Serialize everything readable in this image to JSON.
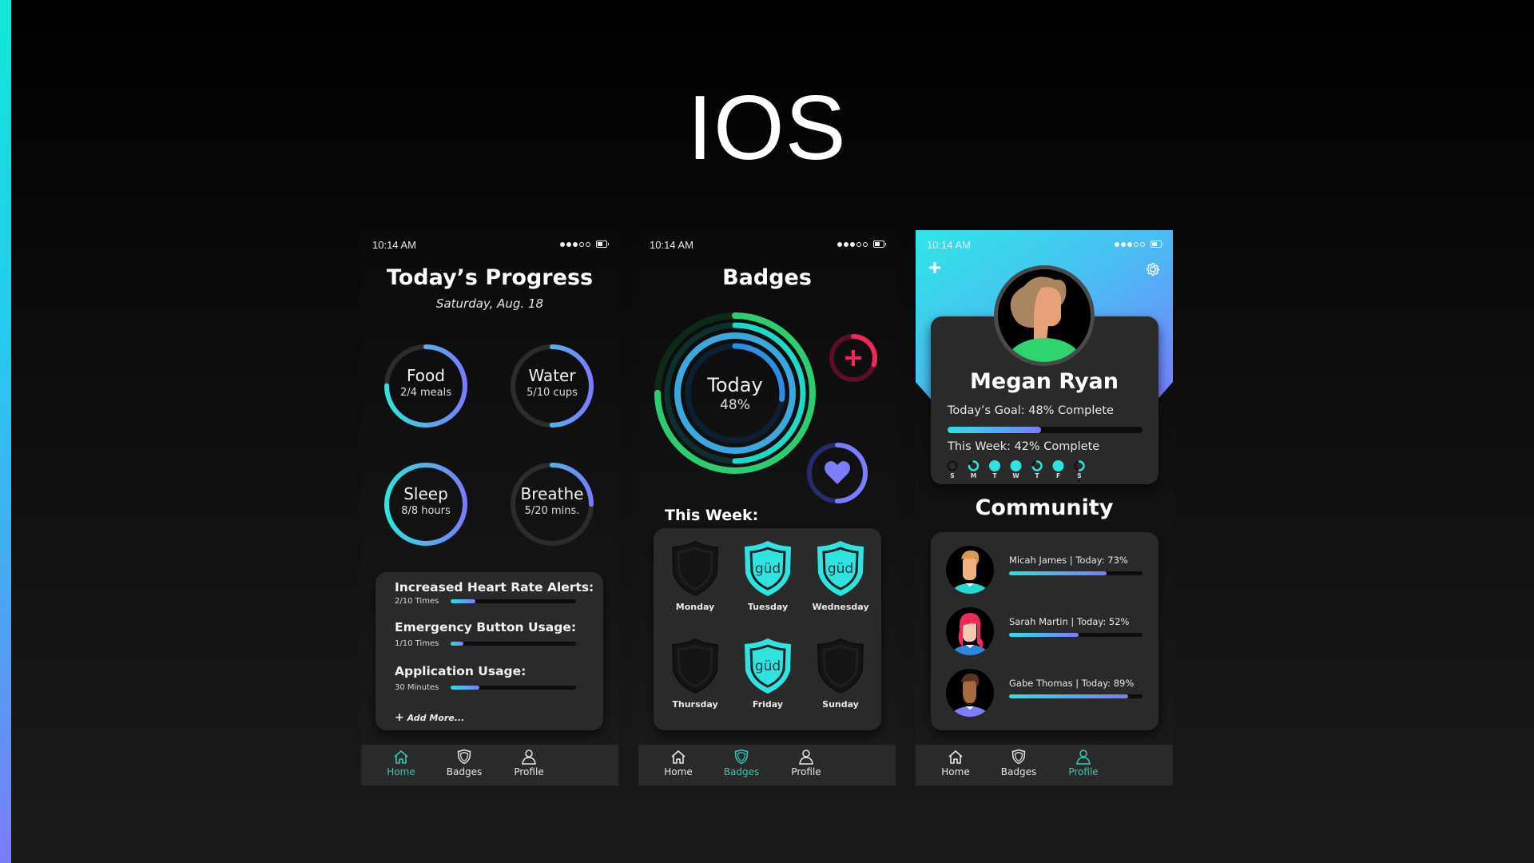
{
  "deck_title": "IOS",
  "accent_colors": {
    "cyan": "#2fe0e0",
    "purple": "#7a7cff",
    "active_tab": "#36c9b8"
  },
  "status_bar": {
    "time": "10:14 AM",
    "signal_icon": "signal-dots-icon",
    "battery_icon": "battery-icon"
  },
  "tabs": [
    {
      "label": "Home",
      "icon": "home-icon"
    },
    {
      "label": "Badges",
      "icon": "shield-icon"
    },
    {
      "label": "Profile",
      "icon": "person-icon"
    }
  ],
  "screens": {
    "progress": {
      "title": "Today’s Progress",
      "date": "Saturday, Aug. 18",
      "active_tab": "Home",
      "rings": [
        {
          "label": "Food",
          "detail": "2/4 meals",
          "progress": 0.75
        },
        {
          "label": "Water",
          "detail": "5/10 cups",
          "progress": 0.5
        },
        {
          "label": "Sleep",
          "detail": "8/8 hours",
          "progress": 1.0
        },
        {
          "label": "Breathe",
          "detail": "5/20 mins.",
          "progress": 0.25
        }
      ],
      "metrics": [
        {
          "title": "Increased Heart Rate Alerts:",
          "detail": "2/10 Times",
          "progress": 0.2
        },
        {
          "title": "Emergency Button Usage:",
          "detail": "1/10 Times",
          "progress": 0.1
        },
        {
          "title": "Application Usage:",
          "detail": "30 Minutes",
          "progress": 0.23
        }
      ],
      "add_more": "Add More..."
    },
    "badges": {
      "title": "Badges",
      "active_tab": "Badges",
      "today_label": "Today",
      "today_value": "48%",
      "activity_rings": [
        {
          "name": "outer",
          "color": "#2ecc71",
          "track": "#0b2a17",
          "progress": 0.75
        },
        {
          "name": "second",
          "color": "#1ed8c8",
          "track": "#0d2f2e",
          "progress": 0.5
        },
        {
          "name": "third",
          "color": "#3aa8dc",
          "track": "#0f2a3a",
          "progress": 1.0
        },
        {
          "name": "inner",
          "color": "#2c8fe3",
          "track": "#0c2033",
          "progress": 0.27
        }
      ],
      "emergency_ring": {
        "icon": "plus-icon",
        "color": "#f0285a",
        "track": "#5a0f24",
        "progress": 0.3
      },
      "heart_ring": {
        "icon": "heart-icon",
        "color": "#7b7cff",
        "track": "#252a6a",
        "progress": 0.5
      },
      "week_label": "This Week:",
      "badge_text": "güd",
      "days": [
        {
          "day": "Monday",
          "earned": false
        },
        {
          "day": "Tuesday",
          "earned": true
        },
        {
          "day": "Wednesday",
          "earned": true
        },
        {
          "day": "Thursday",
          "earned": false
        },
        {
          "day": "Friday",
          "earned": true
        },
        {
          "day": "Sunday",
          "earned": false
        }
      ]
    },
    "profile": {
      "active_tab": "Profile",
      "add_icon": "plus-icon",
      "settings_icon": "gear-icon",
      "name": "Megan Ryan",
      "today_goal": "Today’s Goal: 48% Complete",
      "today_progress": 0.48,
      "this_week": "This Week: 42% Complete",
      "week_days": [
        {
          "d": "S",
          "progress": 0
        },
        {
          "d": "M",
          "progress": 0.75
        },
        {
          "d": "T",
          "progress": 1
        },
        {
          "d": "W",
          "progress": 1
        },
        {
          "d": "T",
          "progress": 0.7
        },
        {
          "d": "F",
          "progress": 1
        },
        {
          "d": "S",
          "progress": 0.5,
          "today": true
        }
      ],
      "community_title": "Community",
      "community": [
        {
          "label": "Micah James | Today: 73%",
          "progress": 0.73,
          "shirt": "#27d8d0",
          "hair": "#d99a55",
          "skin": "#f0b080"
        },
        {
          "label": "Sarah Martin | Today: 52%",
          "progress": 0.52,
          "shirt": "#2f86e0",
          "hair": "#ee2a5a",
          "skin": "#f6c8b0"
        },
        {
          "label": "Gabe Thomas | Today: 89%",
          "progress": 0.89,
          "shirt": "#7b7cff",
          "hair": "#5a3420",
          "skin": "#a86a40"
        }
      ]
    }
  }
}
